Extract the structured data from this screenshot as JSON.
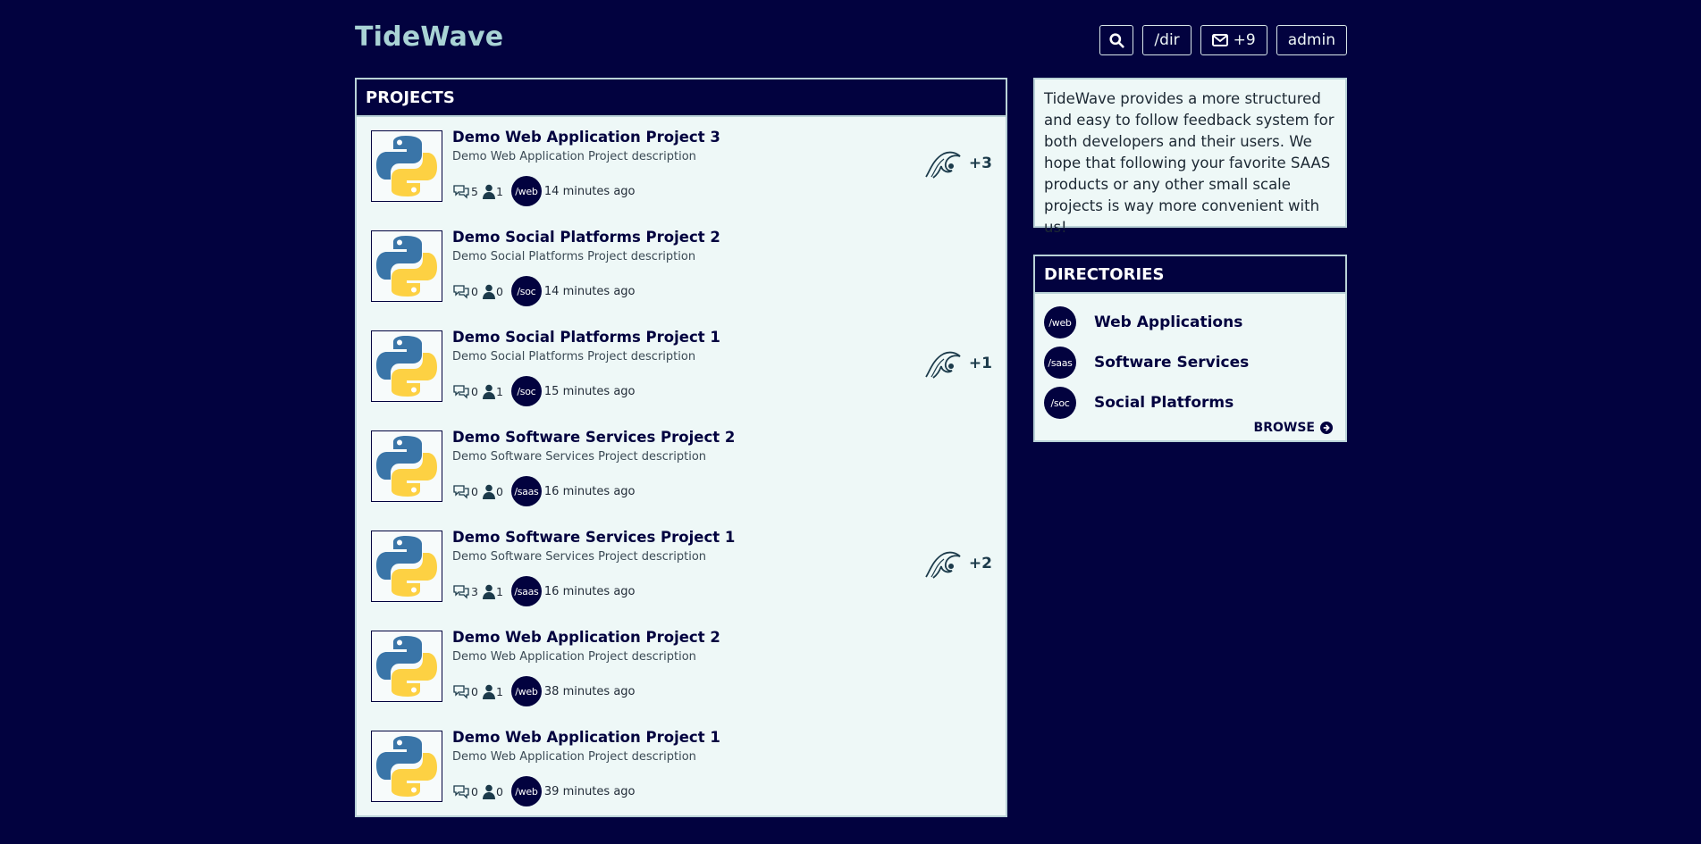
{
  "brand": "TideWave",
  "nav": {
    "dir_label": "/dir",
    "inbox_label": "+9",
    "user_label": "admin"
  },
  "projects": {
    "heading": "PROJECTS",
    "items": [
      {
        "title": "Demo Web Application Project 3",
        "description": "Demo Web Application Project description",
        "comments": "5",
        "followers": "1",
        "dir": "/web",
        "time": "14 minutes ago",
        "waves": "+3"
      },
      {
        "title": "Demo Social Platforms Project 2",
        "description": "Demo Social Platforms Project description",
        "comments": "0",
        "followers": "0",
        "dir": "/soc",
        "time": "14 minutes ago",
        "waves": ""
      },
      {
        "title": "Demo Social Platforms Project 1",
        "description": "Demo Social Platforms Project description",
        "comments": "0",
        "followers": "1",
        "dir": "/soc",
        "time": "15 minutes ago",
        "waves": "+1"
      },
      {
        "title": "Demo Software Services Project 2",
        "description": "Demo Software Services Project description",
        "comments": "0",
        "followers": "0",
        "dir": "/saas",
        "time": "16 minutes ago",
        "waves": ""
      },
      {
        "title": "Demo Software Services Project 1",
        "description": "Demo Software Services Project description",
        "comments": "3",
        "followers": "1",
        "dir": "/saas",
        "time": "16 minutes ago",
        "waves": "+2"
      },
      {
        "title": "Demo Web Application Project 2",
        "description": "Demo Web Application Project description",
        "comments": "0",
        "followers": "1",
        "dir": "/web",
        "time": "38 minutes ago",
        "waves": ""
      },
      {
        "title": "Demo Web Application Project 1",
        "description": "Demo Web Application Project description",
        "comments": "0",
        "followers": "0",
        "dir": "/web",
        "time": "39 minutes ago",
        "waves": ""
      }
    ]
  },
  "about": {
    "text": "TideWave provides a more structured and easy to follow feedback system for both developers and their users. We hope that following your favorite SAAS products or any other small scale projects is way more convenient with us!"
  },
  "directories": {
    "heading": "DIRECTORIES",
    "items": [
      {
        "badge": "/web",
        "name": "Web Applications"
      },
      {
        "badge": "/saas",
        "name": "Software Services"
      },
      {
        "badge": "/soc",
        "name": "Social Platforms"
      }
    ],
    "browse_label": "BROWSE"
  },
  "colors": {
    "background": "#02023f",
    "brand": "#a9d3d5",
    "panel": "#eef8f7"
  },
  "icons": {
    "search": "search-icon",
    "inbox": "envelope-icon",
    "comments": "comments-icon",
    "followers": "user-icon",
    "waves": "wave-icon",
    "browse": "arrow-circle-right-icon"
  }
}
